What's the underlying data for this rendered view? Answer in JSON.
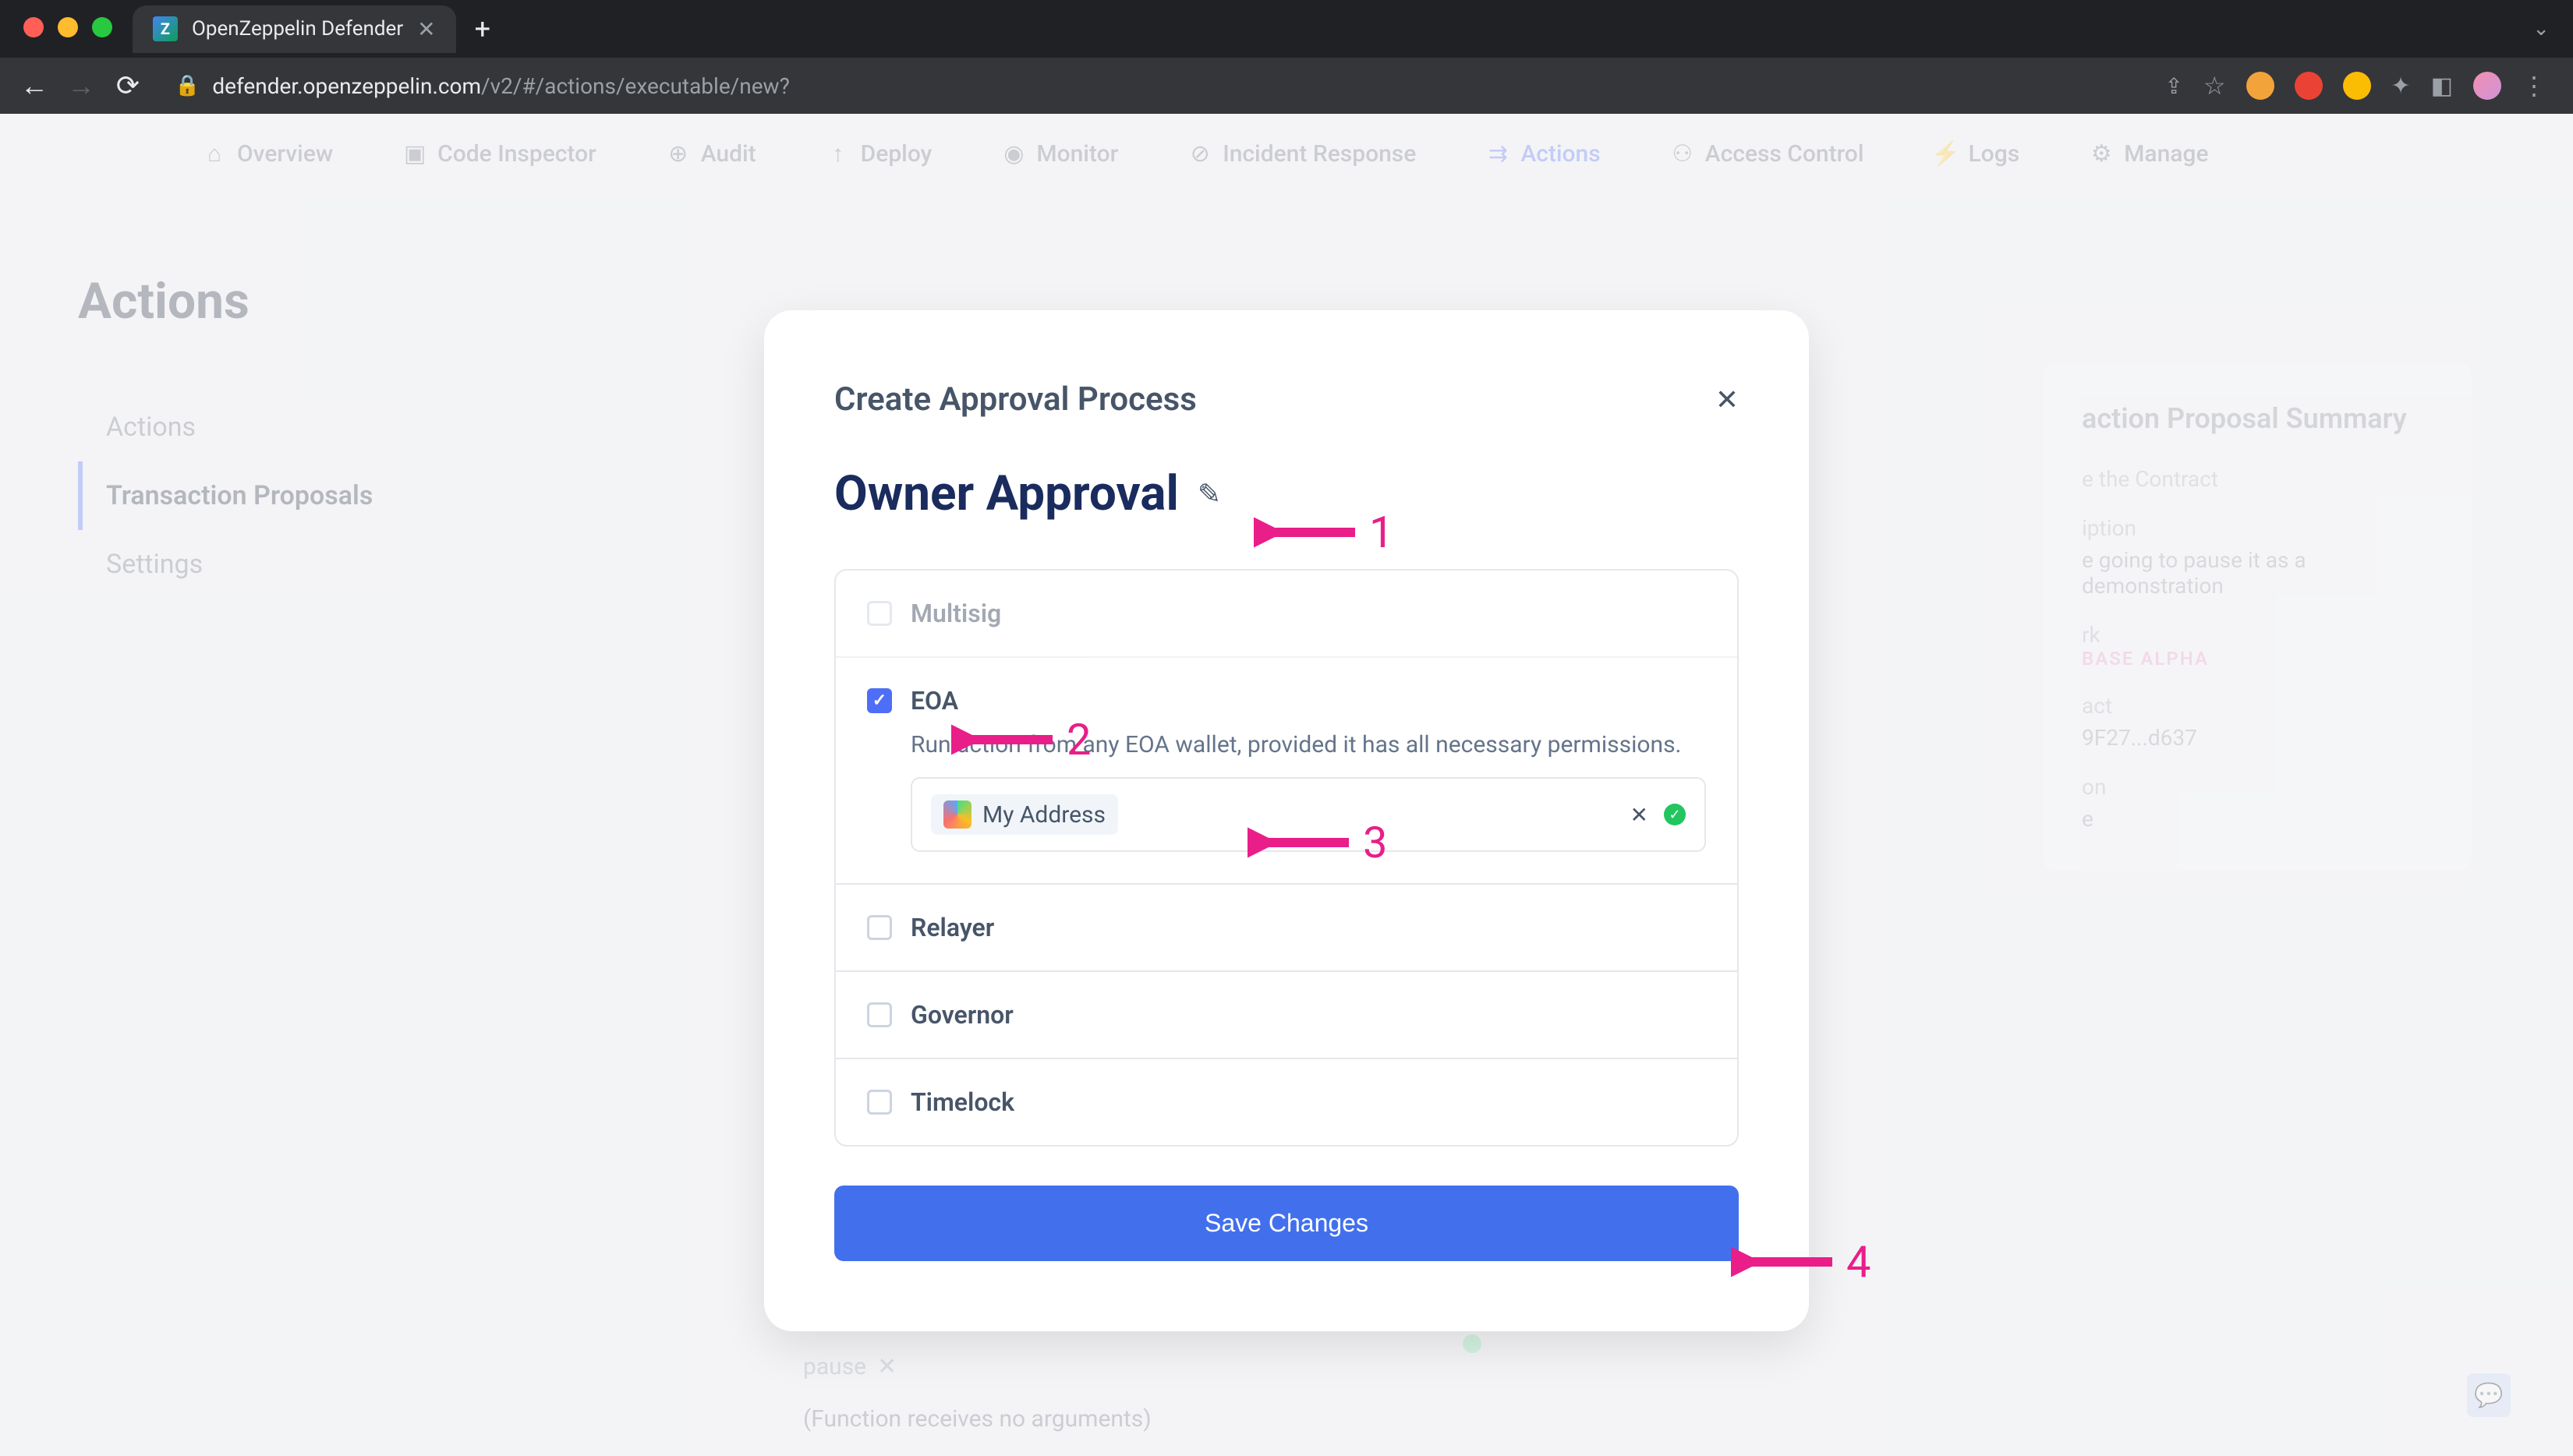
{
  "browser": {
    "tab_title": "OpenZeppelin Defender",
    "url_host": "defender.openzeppelin.com",
    "url_path": "/v2/#/actions/executable/new?"
  },
  "nav": {
    "items": [
      {
        "label": "Overview",
        "icon": "home"
      },
      {
        "label": "Code Inspector",
        "icon": "code"
      },
      {
        "label": "Audit",
        "icon": "shield"
      },
      {
        "label": "Deploy",
        "icon": "upload"
      },
      {
        "label": "Monitor",
        "icon": "eye"
      },
      {
        "label": "Incident Response",
        "icon": "alert"
      },
      {
        "label": "Actions",
        "icon": "flow",
        "active": true
      },
      {
        "label": "Access Control",
        "icon": "users"
      },
      {
        "label": "Logs",
        "icon": "bolt"
      },
      {
        "label": "Manage",
        "icon": "gear"
      }
    ]
  },
  "page": {
    "title": "Actions",
    "sidebar": [
      {
        "label": "Actions"
      },
      {
        "label": "Transaction Proposals",
        "active": true
      },
      {
        "label": "Settings"
      }
    ]
  },
  "modal": {
    "title": "Create Approval Process",
    "name": "Owner Approval",
    "options": {
      "multisig": "Multisig",
      "eoa": "EOA",
      "eoa_desc": "Run action from any EOA wallet, provided it has all necessary permissions.",
      "address_label": "My Address",
      "relayer": "Relayer",
      "governor": "Governor",
      "timelock": "Timelock"
    },
    "save_button": "Save Changes"
  },
  "summary": {
    "title": "action Proposal Summary",
    "fields": {
      "title_label": "e the Contract",
      "desc_label": "iption",
      "desc_value": "e going to pause it as a demonstration",
      "network_label": "rk",
      "network_value": "BASE ALPHA",
      "contract_label": "act",
      "contract_value": "9F27...d637",
      "function_label": "on",
      "function_value": "e"
    }
  },
  "bg": {
    "pause": "pause",
    "no_args": "(Function receives no arguments)"
  },
  "annotations": {
    "a1": "1",
    "a2": "2",
    "a3": "3",
    "a4": "4"
  }
}
